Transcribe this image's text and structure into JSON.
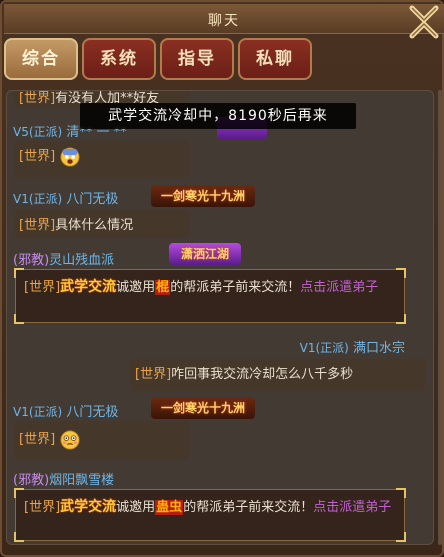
{
  "window": {
    "title": "聊天"
  },
  "tabs": [
    {
      "label": "综合",
      "active": true
    },
    {
      "label": "系统",
      "active": false
    },
    {
      "label": "指导",
      "active": false
    },
    {
      "label": "私聊",
      "active": false
    }
  ],
  "toast": "武学交流冷却中，8190秒后再来",
  "messages": {
    "m1": {
      "channel": "[世界]",
      "text": "有没有人加**好友"
    },
    "m2": {
      "vip": "V5(正派)",
      "name": "清** 一 **",
      "channel": "[世界]",
      "emoji": "scared-face"
    },
    "m3": {
      "vip": "V1(正派)",
      "name": "八门无极",
      "title_badge": "一剑寒光十九洲",
      "channel": "[世界]",
      "text": "具体什么情况"
    },
    "m4": {
      "faction": "(邪教)",
      "name": "灵山残血派",
      "title_badge": "潇洒江湖"
    },
    "sys1": {
      "channel": "[世界]",
      "keyword": "武学交流",
      "prefix": "诚邀用",
      "skill": "棍",
      "suffix": "的帮派弟子前来交流！",
      "link": "点击派遣弟子"
    },
    "m5": {
      "vip": "V1(正派)",
      "name": "满口水宗",
      "channel": "[世界]",
      "text": "咋回事我交流冷却怎么八千多秒"
    },
    "m6": {
      "vip": "V1(正派)",
      "name": "八门无极",
      "title_badge": "一剑寒光十九洲",
      "channel": "[世界]",
      "emoji": "flushed-face"
    },
    "m7": {
      "faction": "(邪教)",
      "name": "烟阳飘雪楼"
    },
    "sys2": {
      "channel": "[世界]",
      "keyword": "武学交流",
      "prefix": "诚邀用",
      "skill": "蛊虫",
      "suffix": "的帮派弟子前来交流！",
      "link": "点击派遣弟子"
    }
  },
  "colors": {
    "channel": "#e9a34a",
    "name": "#6fb4e6",
    "evil": "#c58aee",
    "link": "#c45fd6",
    "highlight": "#ffcc33"
  }
}
